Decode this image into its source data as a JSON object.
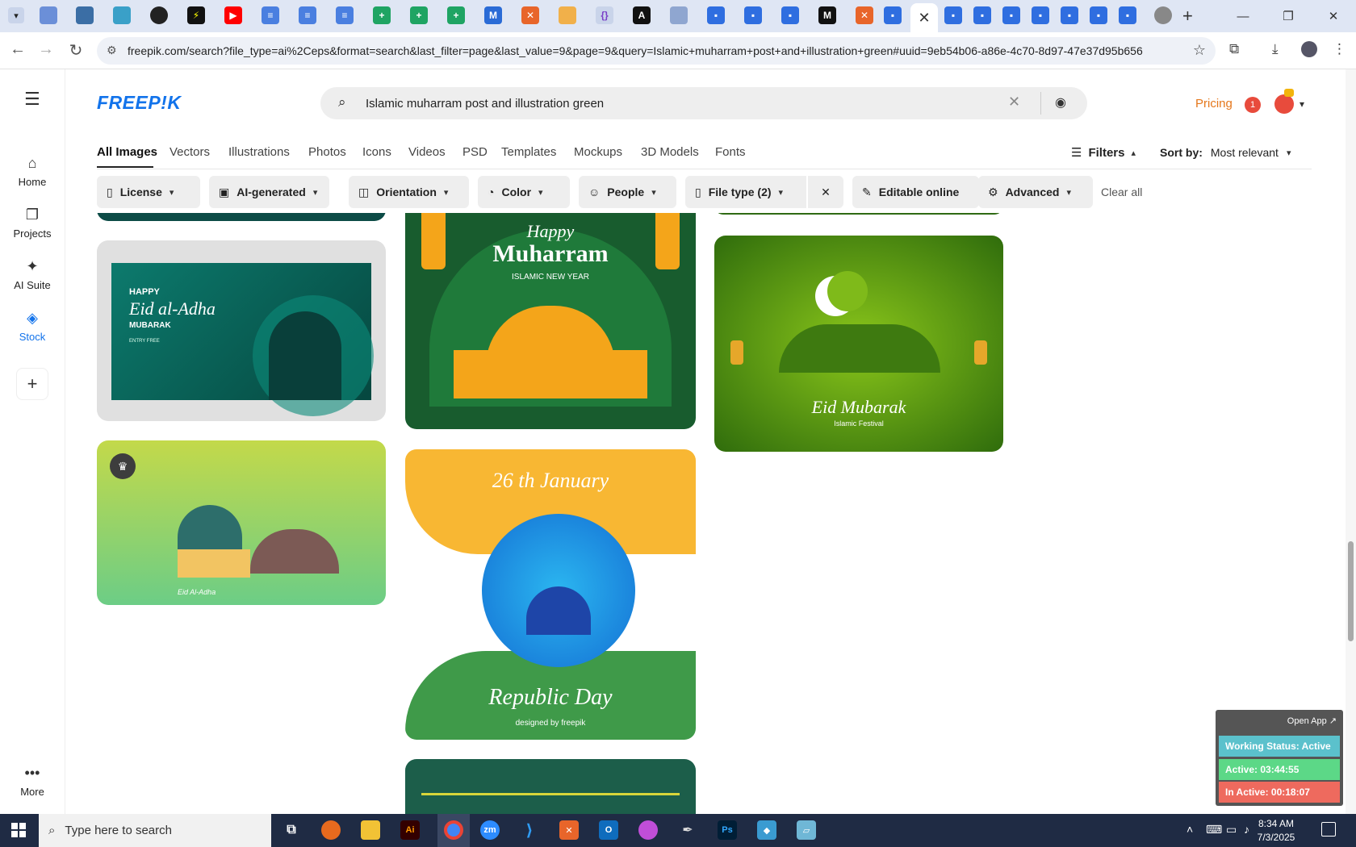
{
  "browser": {
    "url": "freepik.com/search?file_type=ai%2Ceps&format=search&last_filter=page&last_value=9&page=9&query=Islamic+muharram+post+and+illustration+green#uuid=9eb54b06-a86e-4c70-8d97-47e37d95b656",
    "close_tab_glyph": "✕",
    "new_tab_glyph": "+"
  },
  "rail": {
    "items": [
      {
        "label": "Home",
        "icon": "home-icon"
      },
      {
        "label": "Projects",
        "icon": "projects-icon"
      },
      {
        "label": "AI Suite",
        "icon": "sparkle-icon"
      },
      {
        "label": "Stock",
        "icon": "stock-icon"
      }
    ],
    "more_label": "More"
  },
  "header": {
    "logo": "FREEP!K",
    "search_value": "Islamic muharram post and illustration green",
    "pricing_label": "Pricing",
    "notification_count": "1"
  },
  "categories": [
    "All Images",
    "Vectors",
    "Illustrations",
    "Photos",
    "Icons",
    "Videos",
    "PSD",
    "Templates",
    "Mockups",
    "3D Models",
    "Fonts"
  ],
  "filters_label": "Filters",
  "sort": {
    "label": "Sort by:",
    "value": "Most relevant"
  },
  "filter_chips": [
    "License",
    "AI-generated",
    "Orientation",
    "Color",
    "People",
    "File type (2)",
    "Editable online",
    "Advanced"
  ],
  "clear_all": "Clear all",
  "cards": {
    "eid_adha": {
      "line1": "HAPPY",
      "line2": "Eid al-Adha",
      "line3": "MUBARAK",
      "line4": "ENTRY FREE"
    },
    "muharram": {
      "line1": "Happy",
      "line2": "Muharram",
      "line3": "ISLAMIC NEW YEAR"
    },
    "eid_mubarak": {
      "line1": "Eid Mubarak",
      "line2": "Islamic Festival"
    },
    "eid_adha2": {
      "line1": "Eid Al-Adha"
    },
    "republic": {
      "line1": "26 th January",
      "line2": "Republic Day",
      "line3": "designed by freepik"
    }
  },
  "monitor": {
    "open_app": "Open App ↗",
    "status": "Working Status: Active",
    "active": "Active: 03:44:55",
    "inactive": "In Active: 00:18:07"
  },
  "taskbar": {
    "search_placeholder": "Type here to search",
    "time": "8:34 AM",
    "date": "7/3/2025"
  },
  "colors": {
    "accent": "#1273eb",
    "pricing": "#e5771b"
  }
}
